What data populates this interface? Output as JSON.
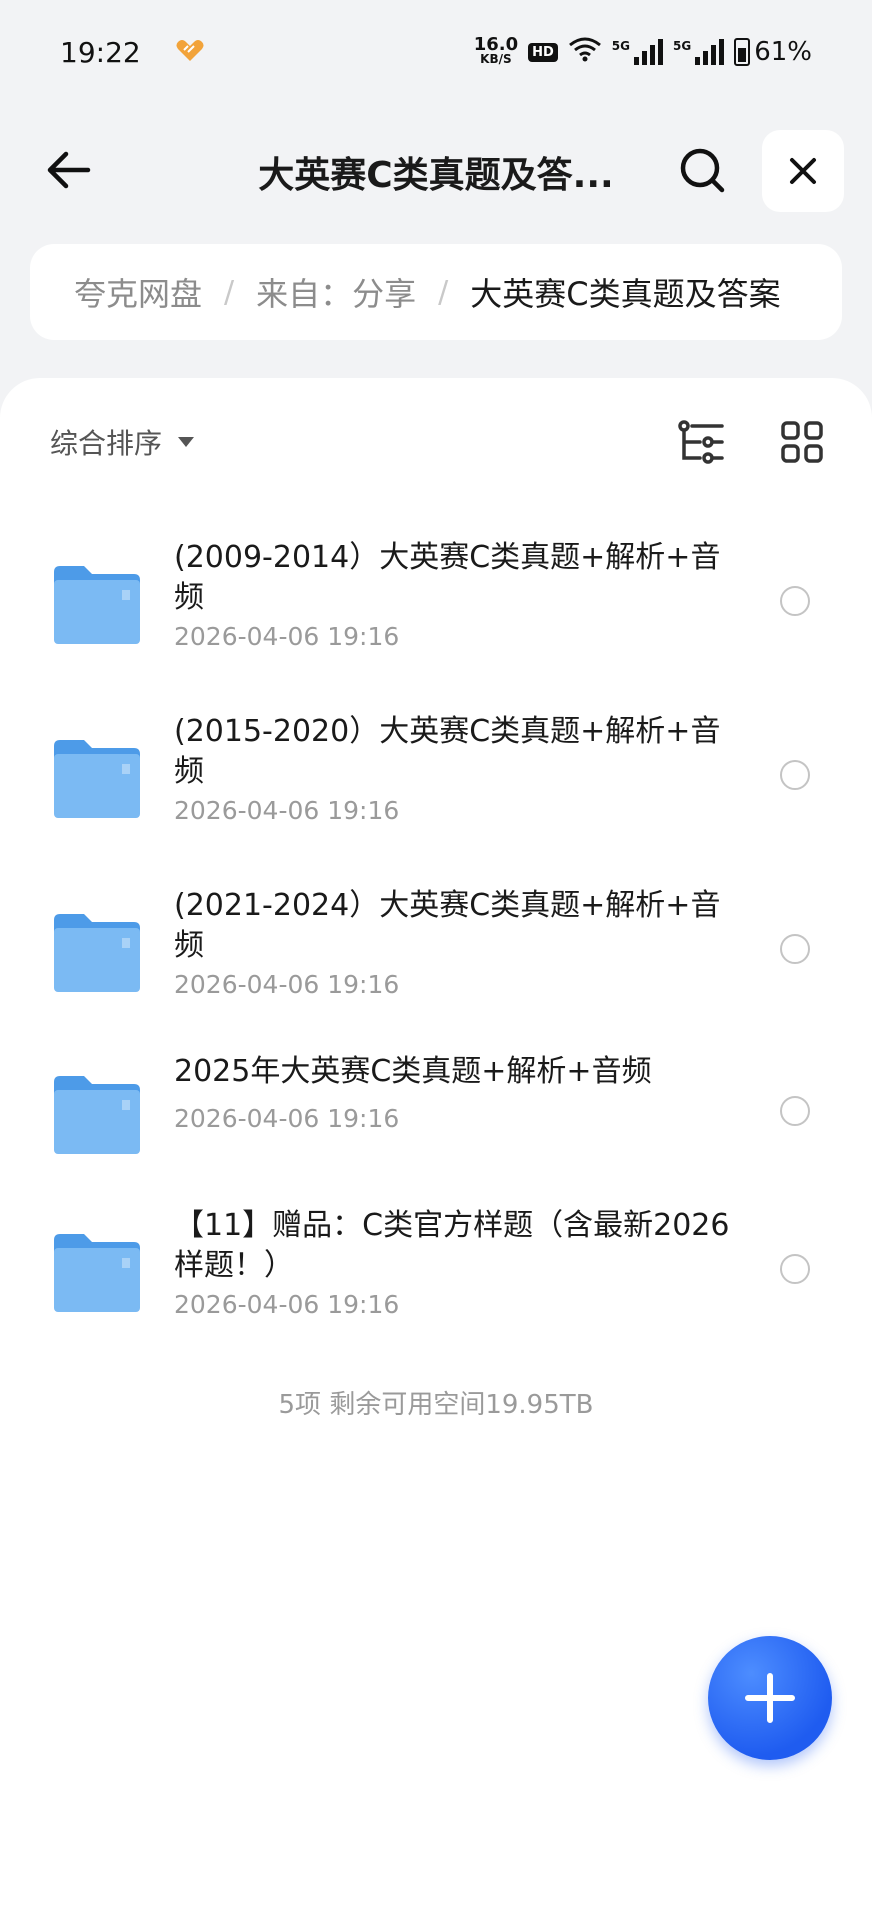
{
  "status_bar": {
    "time": "19:22",
    "net_speed_value": "16.0",
    "net_speed_unit": "KB/S",
    "hd_label": "HD",
    "sim1_label": "5G",
    "sim2_label": "5G",
    "battery_percent": "61%"
  },
  "header": {
    "title": "大英赛C类真题及答...",
    "back_icon": "arrow-left-icon",
    "search_icon": "search-icon",
    "close_icon": "close-icon"
  },
  "breadcrumb": {
    "items": [
      "夸克网盘",
      "来自：分享",
      "大英赛C类真题及答案"
    ],
    "separator": "/"
  },
  "toolbar": {
    "sort_label": "综合排序",
    "tree_icon": "tree-view-icon",
    "grid_icon": "grid-view-icon"
  },
  "files": [
    {
      "name": "(2009-2014）大英赛C类真题+解析+音频",
      "date": "2026-04-06 19:16"
    },
    {
      "name": "(2015-2020）大英赛C类真题+解析+音频",
      "date": "2026-04-06 19:16"
    },
    {
      "name": "(2021-2024）大英赛C类真题+解析+音频",
      "date": "2026-04-06 19:16"
    },
    {
      "name": "2025年大英赛C类真题+解析+音频",
      "date": "2026-04-06 19:16"
    },
    {
      "name": "【11】赠品：C类官方样题（含最新2026样题！）",
      "date": "2026-04-06 19:16"
    }
  ],
  "summary": "5项 剩余可用空间19.95TB",
  "colors": {
    "accent": "#1f5cf0",
    "folder": "#7bbaf3",
    "background": "#f2f3f5"
  }
}
